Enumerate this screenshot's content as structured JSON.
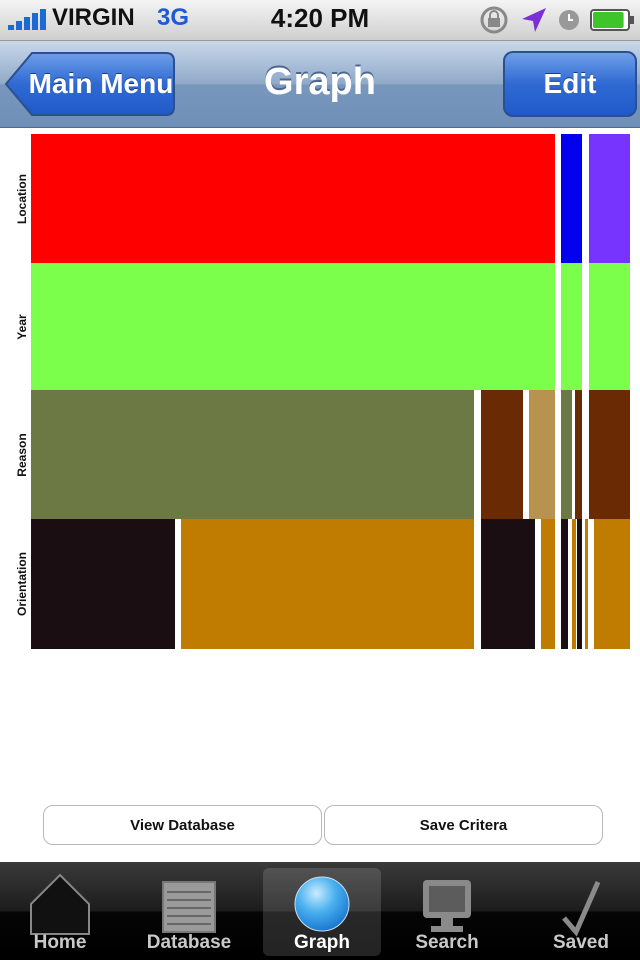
{
  "status_bar": {
    "carrier": "VIRGIN",
    "network": "3G",
    "time": "4:20 PM",
    "signal_bars": 5,
    "icons": [
      "rotation-lock-icon",
      "location-arrow-icon",
      "alarm-clock-icon",
      "battery-icon"
    ],
    "battery_level": 0.9
  },
  "nav_bar": {
    "back_label": "Main Menu",
    "title": "Graph",
    "edit_label": "Edit"
  },
  "graph": {
    "rows": [
      {
        "label": "Location",
        "cells": [
          {
            "start": 0.0,
            "end": 0.875,
            "color": "#ff0000"
          },
          {
            "start": 0.885,
            "end": 0.92,
            "color": "#0000ee"
          },
          {
            "start": 0.932,
            "end": 1.0,
            "color": "#7733ff"
          }
        ]
      },
      {
        "label": "Year",
        "cells": [
          {
            "start": 0.0,
            "end": 0.875,
            "color": "#7bff4a"
          },
          {
            "start": 0.885,
            "end": 0.92,
            "color": "#7bff4a"
          },
          {
            "start": 0.932,
            "end": 1.0,
            "color": "#7bff4a"
          }
        ]
      },
      {
        "label": "Reason",
        "cells": [
          {
            "start": 0.0,
            "end": 0.74,
            "color": "#6d7945"
          },
          {
            "start": 0.752,
            "end": 0.822,
            "color": "#6a2a04"
          },
          {
            "start": 0.832,
            "end": 0.875,
            "color": "#b8924f"
          },
          {
            "start": 0.885,
            "end": 0.903,
            "color": "#6d7945"
          },
          {
            "start": 0.908,
            "end": 0.92,
            "color": "#6a2a04"
          },
          {
            "start": 0.932,
            "end": 1.0,
            "color": "#6a2a04"
          }
        ]
      },
      {
        "label": "Orientation",
        "cells": [
          {
            "start": 0.0,
            "end": 0.24,
            "color": "#1b0e12"
          },
          {
            "start": 0.25,
            "end": 0.74,
            "color": "#bf7c00"
          },
          {
            "start": 0.752,
            "end": 0.842,
            "color": "#1b0e12"
          },
          {
            "start": 0.852,
            "end": 0.875,
            "color": "#bf7c00"
          },
          {
            "start": 0.885,
            "end": 0.897,
            "color": "#1b0e12"
          },
          {
            "start": 0.903,
            "end": 0.91,
            "color": "#bf7c00"
          },
          {
            "start": 0.912,
            "end": 0.92,
            "color": "#1b0e12"
          },
          {
            "start": 0.925,
            "end": 0.93,
            "color": "#bf7c00"
          },
          {
            "start": 0.94,
            "end": 1.0,
            "color": "#bf7c00"
          }
        ]
      }
    ]
  },
  "actions": {
    "view_database": "View Database",
    "save_criteria": "Save Critera"
  },
  "tab_bar": {
    "tabs": [
      {
        "label": "Home",
        "icon": "home-icon"
      },
      {
        "label": "Database",
        "icon": "database-icon"
      },
      {
        "label": "Graph",
        "icon": "graph-icon",
        "active": true
      },
      {
        "label": "Search",
        "icon": "search-icon"
      },
      {
        "label": "Saved",
        "icon": "saved-icon"
      }
    ]
  }
}
